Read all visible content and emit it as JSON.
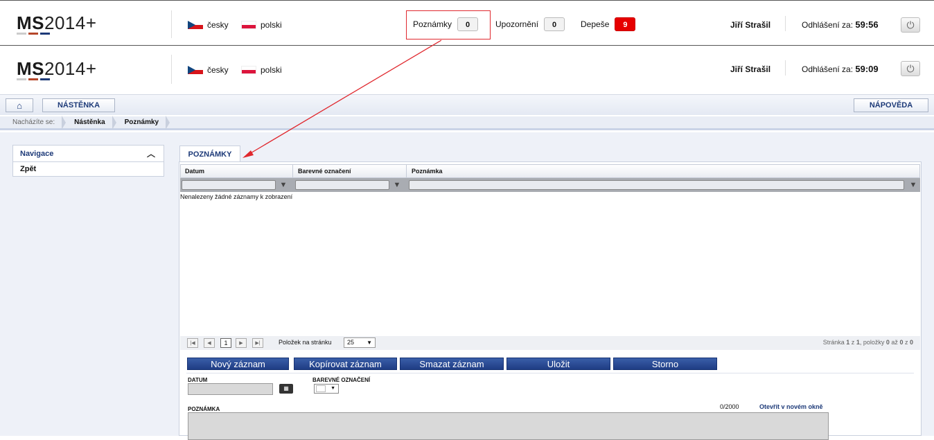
{
  "logo": {
    "bold": "MS",
    "rest": "2014+"
  },
  "languages": [
    {
      "label": "česky",
      "flag": "cz-flag"
    },
    {
      "label": "polski",
      "flag": "pl-flag"
    }
  ],
  "top_counters": [
    {
      "label": "Poznámky",
      "value": "0"
    },
    {
      "label": "Upozornění",
      "value": "0"
    },
    {
      "label": "Depeše",
      "value": "9"
    }
  ],
  "header1": {
    "user": "Jiří Strašil",
    "logout_label": "Odhlášení za:",
    "logout_time": "59:56"
  },
  "header2": {
    "user": "Jiří Strašil",
    "logout_label": "Odhlášení za:",
    "logout_time": "59:09"
  },
  "toolbar": {
    "dashboard_label": "NÁSTĚNKA",
    "help_label": "NÁPOVĚDA"
  },
  "breadcrumb": {
    "prefix": "Nacházíte se:",
    "items": [
      "Nástěnka",
      "Poznámky"
    ]
  },
  "navigation": {
    "title": "Navigace",
    "items": [
      "Zpět"
    ]
  },
  "panel": {
    "tab": "POZNÁMKY",
    "columns": [
      "Datum",
      "Barevné označení",
      "Poznámka"
    ],
    "empty_message": "Nenalezeny žádné záznamy k zobrazení",
    "pager": {
      "current_page": "1",
      "page_size_label": "Položek na stránku",
      "page_size": "25",
      "summary_a": "Stránka",
      "page": "1",
      "of": "z",
      "total_pages": "1",
      "items_label": ", položky",
      "from": "0",
      "to_label": "až",
      "to": "0",
      "of2": "z",
      "total": "0"
    },
    "actions": [
      "Nový záznam",
      "Kopírovat záznam",
      "Smazat záznam",
      "Uložit",
      "Storno"
    ],
    "form": {
      "date_label": "DATUM",
      "color_label": "BAREVNÉ OZNAČENÍ",
      "note_label": "POZNÁMKA",
      "char_count": "0/2000",
      "open_new_window": "Otevřít v novém okně"
    }
  },
  "colors": {
    "accent": "#1d3a78",
    "alert": "#e60000",
    "highlight": "#e0282e",
    "logo_bars": [
      "#cccccc",
      "#b5462a",
      "#1d3a78"
    ]
  }
}
